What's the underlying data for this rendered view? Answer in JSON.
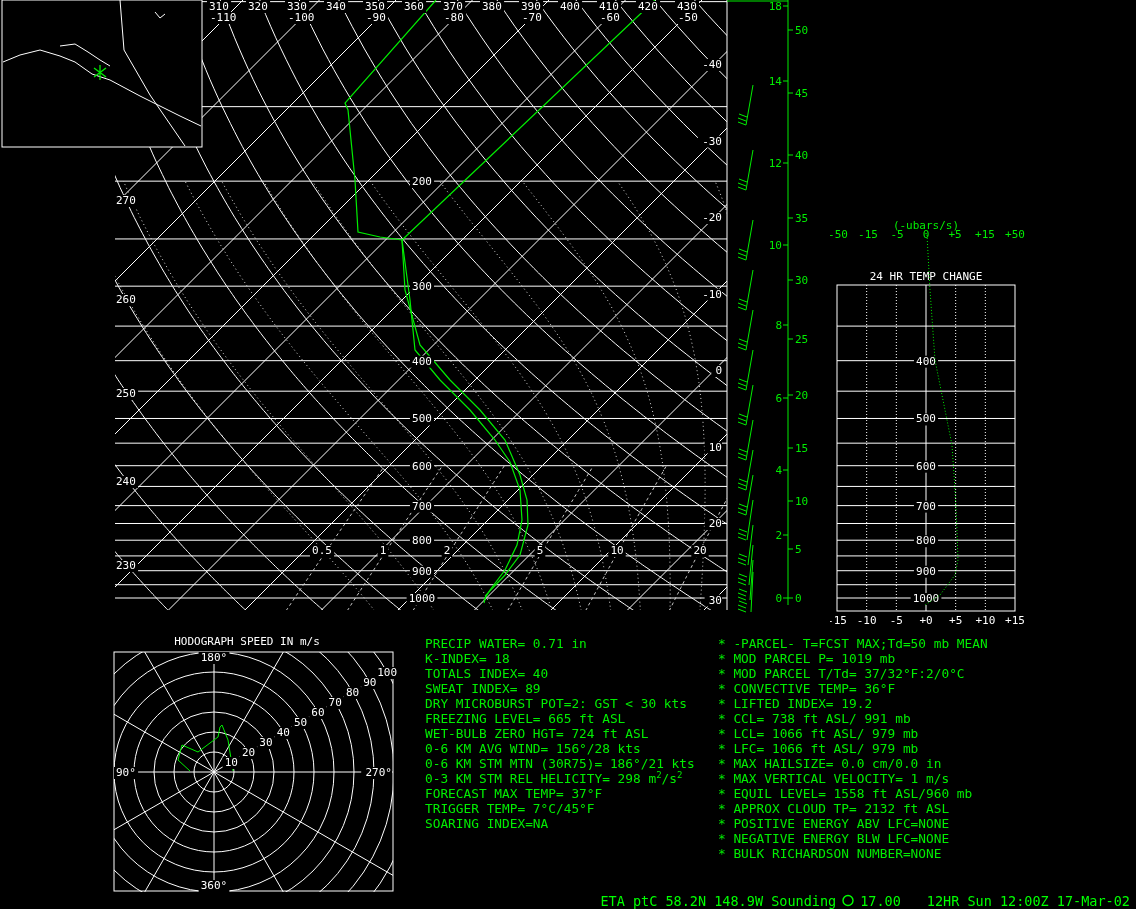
{
  "skew_t": {
    "theta_top_labels": [
      "310",
      "320",
      "330",
      "340",
      "350",
      "360",
      "370",
      "380",
      "390",
      "400",
      "410",
      "420",
      "430"
    ],
    "isotherm_top_labels": [
      "-110",
      "-100",
      "-90",
      "-80",
      "-70",
      "-60",
      "-50"
    ],
    "theta_left_labels": [
      "270",
      "260",
      "250",
      "240",
      "230"
    ],
    "pressure_labels": [
      "200",
      "300",
      "400",
      "500",
      "600",
      "700",
      "800",
      "900",
      "1000"
    ],
    "isotherm_right_labels": [
      "-40",
      "-30",
      "-20",
      "-10",
      "0",
      "10",
      "20",
      "30"
    ],
    "mixing_ratio_labels": [
      "0.5",
      "1",
      "2",
      "5",
      "10",
      "20"
    ],
    "km_labels": [
      "18",
      "14",
      "12",
      "10",
      "8",
      "6",
      "4",
      "2",
      "0"
    ],
    "kft_labels": [
      "50",
      "45",
      "40",
      "35",
      "30",
      "25",
      "20",
      "15",
      "10",
      "5",
      "0"
    ]
  },
  "temp_change": {
    "omega_unit": "(-ubars/s)",
    "omega_labels": [
      "-50",
      "-15",
      "-5",
      "0",
      "+5",
      "+15",
      "+50"
    ],
    "title": "24 HR TEMP CHANGE",
    "pressure_labels": [
      "400",
      "500",
      "600",
      "700",
      "800",
      "900",
      "1000"
    ],
    "x_labels": [
      "-15",
      "-10",
      "-5",
      "+0",
      "+5",
      "+10",
      "+15"
    ]
  },
  "hodograph": {
    "title": "HODOGRAPH SPEED IN m/s",
    "direction_labels": [
      "180°",
      "90°",
      "270°",
      "360°"
    ],
    "speed_labels": [
      "10",
      "20",
      "30",
      "40",
      "50",
      "60",
      "70",
      "80",
      "90",
      "100"
    ]
  },
  "indices": [
    "PRECIP WATER= 0.71 in",
    "K-INDEX= 18",
    "TOTALS INDEX= 40",
    "SWEAT INDEX= 89",
    "DRY MICROBURST POT=2: GST < 30 kts",
    "FREEZING LEVEL= 665 ft ASL",
    "WET-BULB ZERO HGT= 724 ft ASL",
    "0-6 KM AVG WIND= 156°/28 kts",
    "0-6 KM STM MTN (30R75)= 186°/21 kts",
    "0-3 KM STM REL HELICITY= 298 m$^{2}$/s$^{2}$",
    "FORECAST MAX TEMP= 37°F",
    "TRIGGER TEMP= 7°C/45°F",
    "SOARING INDEX=NA"
  ],
  "parcel_info": [
    "* -PARCEL- T=FCST MAX;Td=50 mb MEAN",
    "* MOD PARCEL P= 1019 mb",
    "* MOD PARCEL T/Td= 37/32°F:2/0°C",
    "* CONVECTIVE TEMP= 36°F",
    "* LIFTED INDEX= 19.2",
    "* CCL= 738 ft ASL/ 991 mb",
    "* LCL= 1066 ft ASL/ 979 mb",
    "* LFC= 1066 ft ASL/ 979 mb",
    "* MAX HAILSIZE= 0.0 cm/0.0 in",
    "* MAX VERTICAL VELOCITY= 1 m/s",
    "* EQUIL LEVEL= 1558 ft ASL/960 mb",
    "* APPROX CLOUD TP= 2132 ft ASL",
    "* POSITIVE ENERGY ABV LFC=NONE",
    "* NEGATIVE ENERGY BLW LFC=NONE",
    "* BULK RICHARDSON NUMBER=NONE"
  ],
  "status_bar": {
    "location": "ETA ptC 58.2N 148.9W Sounding",
    "value": "17.00",
    "valid_time": "12HR Sun 12:00Z 17-Mar-02"
  }
}
